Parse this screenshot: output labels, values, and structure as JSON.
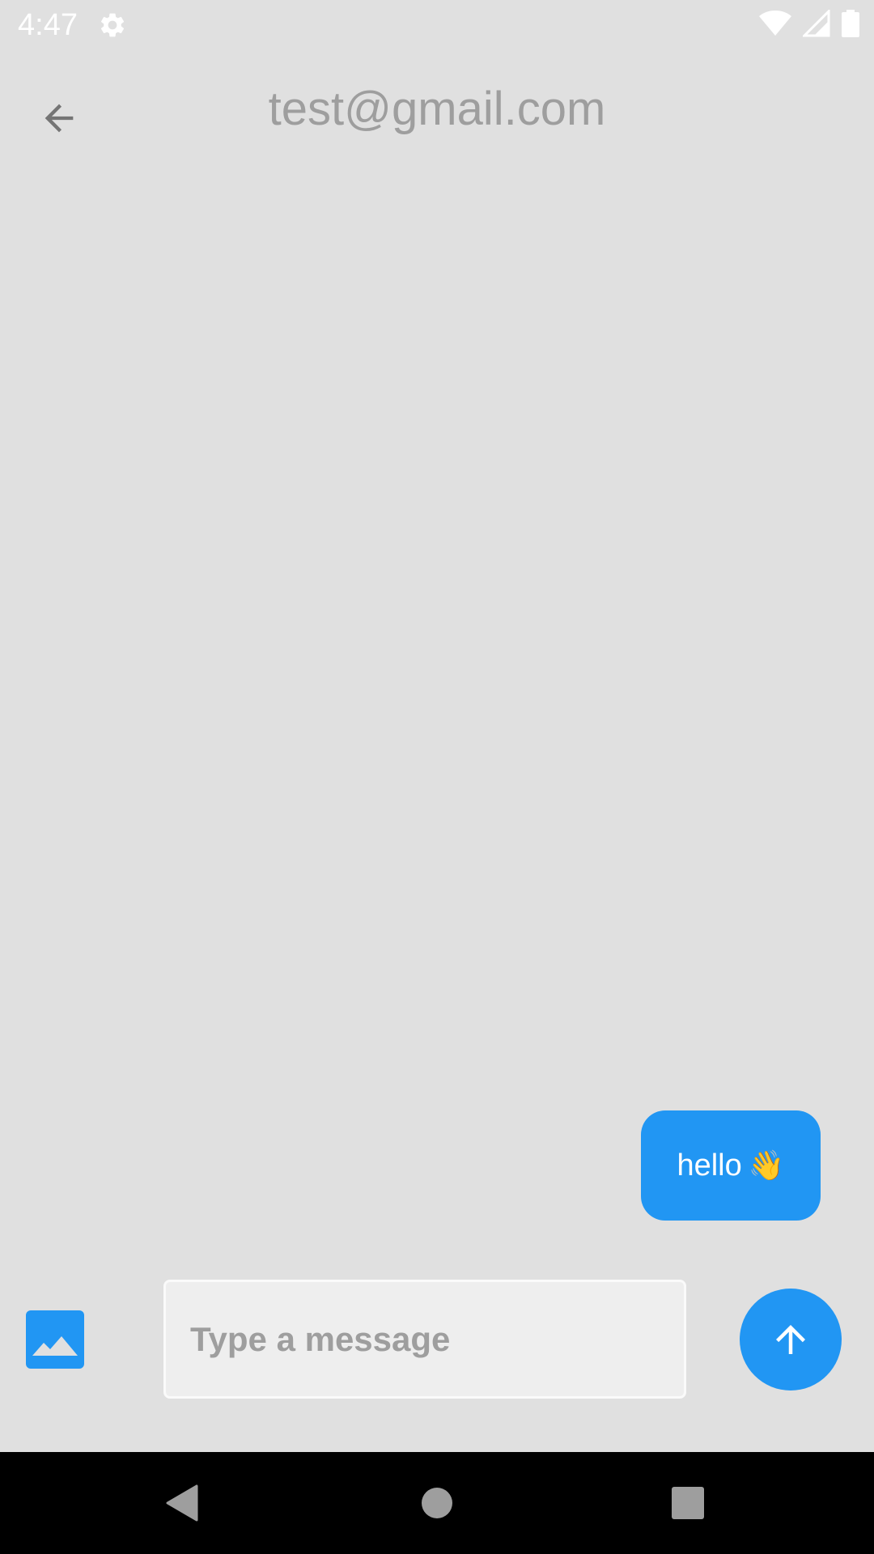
{
  "status_bar": {
    "time": "4:47",
    "icons": [
      "settings-gear-icon",
      "wifi-icon",
      "cellular-signal-icon",
      "battery-icon"
    ]
  },
  "app_bar": {
    "title": "test@gmail.com",
    "back_icon": "arrow-back-icon"
  },
  "messages": [
    {
      "text": "hello",
      "emoji": "👋",
      "sender": "me"
    }
  ],
  "composer": {
    "placeholder": "Type a message",
    "value": "",
    "image_icon": "image-icon",
    "send_icon": "arrow-up-icon"
  },
  "nav_bar": {
    "buttons": [
      "back-triangle-icon",
      "home-circle-icon",
      "recents-square-icon"
    ]
  },
  "colors": {
    "background": "#E0E0E0",
    "accent": "#2196F3",
    "title_text": "#9E9E9E",
    "input_background": "#EEEEEE",
    "nav_bar": "#000000"
  }
}
